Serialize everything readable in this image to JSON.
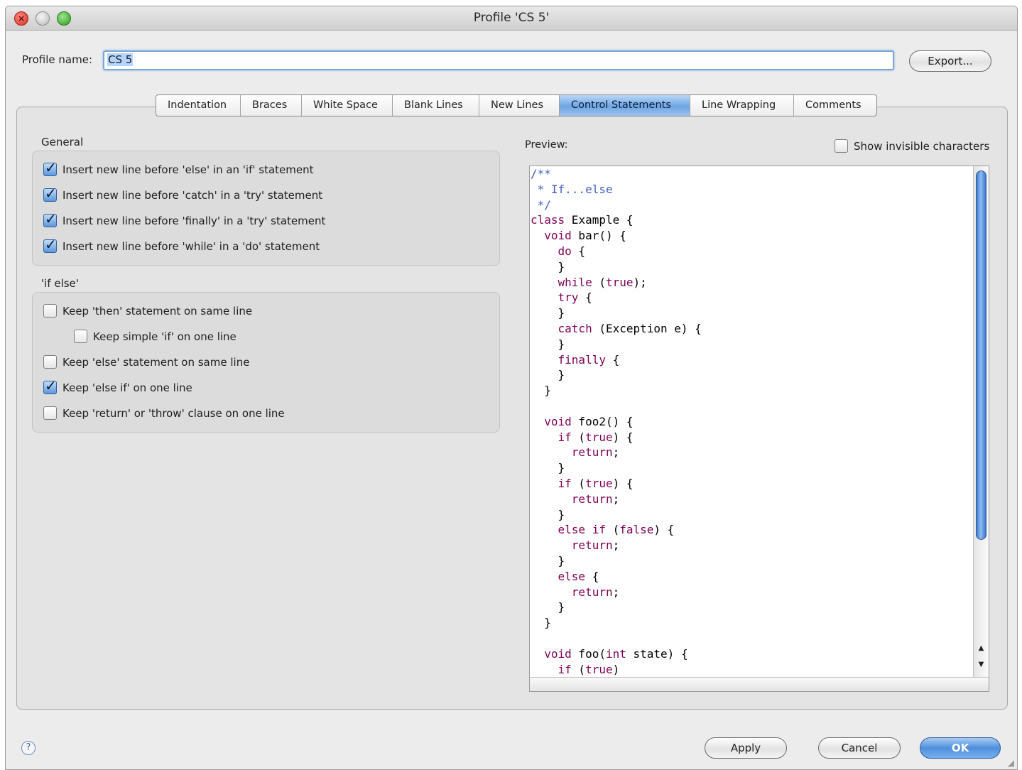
{
  "window": {
    "title": "Profile 'CS 5'"
  },
  "profile": {
    "label": "Profile name:",
    "value": "CS 5",
    "export_label": "Export..."
  },
  "tabs": [
    {
      "label": "Indentation",
      "active": false
    },
    {
      "label": "Braces",
      "active": false
    },
    {
      "label": "White Space",
      "active": false
    },
    {
      "label": "Blank Lines",
      "active": false
    },
    {
      "label": "New Lines",
      "active": false
    },
    {
      "label": "Control Statements",
      "active": true
    },
    {
      "label": "Line Wrapping",
      "active": false
    },
    {
      "label": "Comments",
      "active": false
    }
  ],
  "general": {
    "title": "General",
    "options": [
      {
        "label": "Insert new line before 'else' in an 'if' statement",
        "checked": true
      },
      {
        "label": "Insert new line before 'catch' in a 'try' statement",
        "checked": true
      },
      {
        "label": "Insert new line before 'finally' in a 'try' statement",
        "checked": true
      },
      {
        "label": "Insert new line before 'while' in a 'do' statement",
        "checked": true
      }
    ]
  },
  "ifelse": {
    "title": "'if else'",
    "options": [
      {
        "label": "Keep 'then' statement on same line",
        "checked": false
      },
      {
        "label": "Keep simple 'if' on one line",
        "checked": false
      },
      {
        "label": "Keep 'else' statement on same line",
        "checked": false
      },
      {
        "label": "Keep 'else if' on one line",
        "checked": true
      },
      {
        "label": "Keep 'return' or 'throw' clause on one line",
        "checked": false
      }
    ]
  },
  "preview": {
    "label": "Preview:",
    "show_invisible_label": "Show invisible characters",
    "show_invisible_checked": false,
    "code_lines": [
      [
        {
          "t": "/**",
          "c": "comment"
        }
      ],
      [
        {
          "t": " * If...else",
          "c": "comment"
        }
      ],
      [
        {
          "t": " */",
          "c": "comment"
        }
      ],
      [
        {
          "t": "class",
          "c": "kw"
        },
        {
          "t": " Example {",
          "c": "plain"
        }
      ],
      [
        {
          "t": "  ",
          "c": "plain"
        },
        {
          "t": "void",
          "c": "kw"
        },
        {
          "t": " bar() {",
          "c": "plain"
        }
      ],
      [
        {
          "t": "    ",
          "c": "plain"
        },
        {
          "t": "do",
          "c": "kw"
        },
        {
          "t": " {",
          "c": "plain"
        }
      ],
      [
        {
          "t": "    }",
          "c": "plain"
        }
      ],
      [
        {
          "t": "    ",
          "c": "plain"
        },
        {
          "t": "while",
          "c": "kw"
        },
        {
          "t": " (",
          "c": "plain"
        },
        {
          "t": "true",
          "c": "kw"
        },
        {
          "t": ");",
          "c": "plain"
        }
      ],
      [
        {
          "t": "    ",
          "c": "plain"
        },
        {
          "t": "try",
          "c": "kw"
        },
        {
          "t": " {",
          "c": "plain"
        }
      ],
      [
        {
          "t": "    }",
          "c": "plain"
        }
      ],
      [
        {
          "t": "    ",
          "c": "plain"
        },
        {
          "t": "catch",
          "c": "kw"
        },
        {
          "t": " (Exception e) {",
          "c": "plain"
        }
      ],
      [
        {
          "t": "    }",
          "c": "plain"
        }
      ],
      [
        {
          "t": "    ",
          "c": "plain"
        },
        {
          "t": "finally",
          "c": "kw"
        },
        {
          "t": " {",
          "c": "plain"
        }
      ],
      [
        {
          "t": "    }",
          "c": "plain"
        }
      ],
      [
        {
          "t": "  }",
          "c": "plain"
        }
      ],
      [
        {
          "t": "",
          "c": "plain"
        }
      ],
      [
        {
          "t": "  ",
          "c": "plain"
        },
        {
          "t": "void",
          "c": "kw"
        },
        {
          "t": " foo2() {",
          "c": "plain"
        }
      ],
      [
        {
          "t": "    ",
          "c": "plain"
        },
        {
          "t": "if",
          "c": "kw"
        },
        {
          "t": " (",
          "c": "plain"
        },
        {
          "t": "true",
          "c": "kw"
        },
        {
          "t": ") {",
          "c": "plain"
        }
      ],
      [
        {
          "t": "      ",
          "c": "plain"
        },
        {
          "t": "return",
          "c": "kw"
        },
        {
          "t": ";",
          "c": "plain"
        }
      ],
      [
        {
          "t": "    }",
          "c": "plain"
        }
      ],
      [
        {
          "t": "    ",
          "c": "plain"
        },
        {
          "t": "if",
          "c": "kw"
        },
        {
          "t": " (",
          "c": "plain"
        },
        {
          "t": "true",
          "c": "kw"
        },
        {
          "t": ") {",
          "c": "plain"
        }
      ],
      [
        {
          "t": "      ",
          "c": "plain"
        },
        {
          "t": "return",
          "c": "kw"
        },
        {
          "t": ";",
          "c": "plain"
        }
      ],
      [
        {
          "t": "    }",
          "c": "plain"
        }
      ],
      [
        {
          "t": "    ",
          "c": "plain"
        },
        {
          "t": "else",
          "c": "kw"
        },
        {
          "t": " ",
          "c": "plain"
        },
        {
          "t": "if",
          "c": "kw"
        },
        {
          "t": " (",
          "c": "plain"
        },
        {
          "t": "false",
          "c": "kw"
        },
        {
          "t": ") {",
          "c": "plain"
        }
      ],
      [
        {
          "t": "      ",
          "c": "plain"
        },
        {
          "t": "return",
          "c": "kw"
        },
        {
          "t": ";",
          "c": "plain"
        }
      ],
      [
        {
          "t": "    }",
          "c": "plain"
        }
      ],
      [
        {
          "t": "    ",
          "c": "plain"
        },
        {
          "t": "else",
          "c": "kw"
        },
        {
          "t": " {",
          "c": "plain"
        }
      ],
      [
        {
          "t": "      ",
          "c": "plain"
        },
        {
          "t": "return",
          "c": "kw"
        },
        {
          "t": ";",
          "c": "plain"
        }
      ],
      [
        {
          "t": "    }",
          "c": "plain"
        }
      ],
      [
        {
          "t": "  }",
          "c": "plain"
        }
      ],
      [
        {
          "t": "",
          "c": "plain"
        }
      ],
      [
        {
          "t": "  ",
          "c": "plain"
        },
        {
          "t": "void",
          "c": "kw"
        },
        {
          "t": " foo(",
          "c": "plain"
        },
        {
          "t": "int",
          "c": "kw"
        },
        {
          "t": " state) {",
          "c": "plain"
        }
      ],
      [
        {
          "t": "    ",
          "c": "plain"
        },
        {
          "t": "if",
          "c": "kw"
        },
        {
          "t": " (",
          "c": "plain"
        },
        {
          "t": "true",
          "c": "kw"
        },
        {
          "t": ")",
          "c": "plain"
        }
      ]
    ]
  },
  "footer": {
    "help_icon": "question-icon",
    "apply_label": "Apply",
    "cancel_label": "Cancel",
    "ok_label": "OK"
  },
  "colors": {
    "accent": "#5c97dd",
    "code_keyword": "#7f0055",
    "code_comment": "#3f5fbf"
  }
}
